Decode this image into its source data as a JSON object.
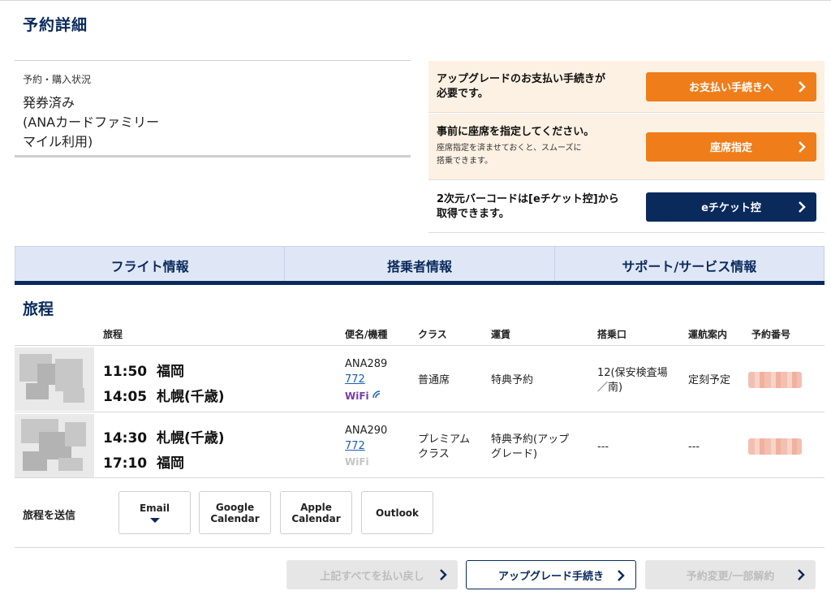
{
  "page": {
    "title": "予約詳細"
  },
  "status": {
    "label": "予約・購入状況",
    "value": "発券済み\n(ANAカードファミリー\nマイル利用)"
  },
  "actions": [
    {
      "main": "アップグレードのお支払い手続きが\n必要です。",
      "sub": "",
      "button": "お支払い手続きへ"
    },
    {
      "main": "事前に座席を指定してください。",
      "sub": "座席指定を済ませておくと、スムーズに\n搭乗できます。",
      "button": "座席指定"
    },
    {
      "main": "2次元バーコードは[eチケット控]から\n取得できます。",
      "sub": "",
      "button": "eチケット控"
    }
  ],
  "tabs": [
    "フライト情報",
    "搭乗者情報",
    "サポート/サービス情報"
  ],
  "itinerary": {
    "title": "旅程",
    "headers": {
      "route": "旅程",
      "flight": "便名/機種",
      "class": "クラス",
      "fare": "運賃",
      "gate": "搭乗口",
      "status": "運航案内",
      "pnr": "予約番号"
    },
    "rows": [
      {
        "dep_time": "11:50",
        "dep_city": "福岡",
        "arr_time": "14:05",
        "arr_city": "札幌(千歳)",
        "flight": "ANA289",
        "aircraft": "772",
        "wifi": "WiFi",
        "wifi_available": true,
        "class": "普通席",
        "fare": "特典予約",
        "gate": "12(保安検査場\n／南)",
        "status": "定刻予定"
      },
      {
        "dep_time": "14:30",
        "dep_city": "札幌(千歳)",
        "arr_time": "17:10",
        "arr_city": "福岡",
        "flight": "ANA290",
        "aircraft": "772",
        "wifi": "WiFi",
        "wifi_available": false,
        "class": "プレミアム\nクラス",
        "fare": "特典予約(アップ\nグレード)",
        "gate": "---",
        "status": "---"
      }
    ]
  },
  "send": {
    "label": "旅程を送信",
    "buttons": [
      "Email",
      "Google\nCalendar",
      "Apple\nCalendar",
      "Outlook"
    ]
  },
  "bottom_buttons": [
    {
      "label": "上記すべてを払い戻し",
      "enabled": false
    },
    {
      "label": "アップグレード手続き",
      "enabled": true
    },
    {
      "label": "予約変更/一部解約",
      "enabled": false
    }
  ],
  "colors": {
    "navy": "#0a2a5c",
    "orange": "#ef7d1a",
    "link": "#1a5fb4",
    "wifi": "#7a3aa8"
  }
}
